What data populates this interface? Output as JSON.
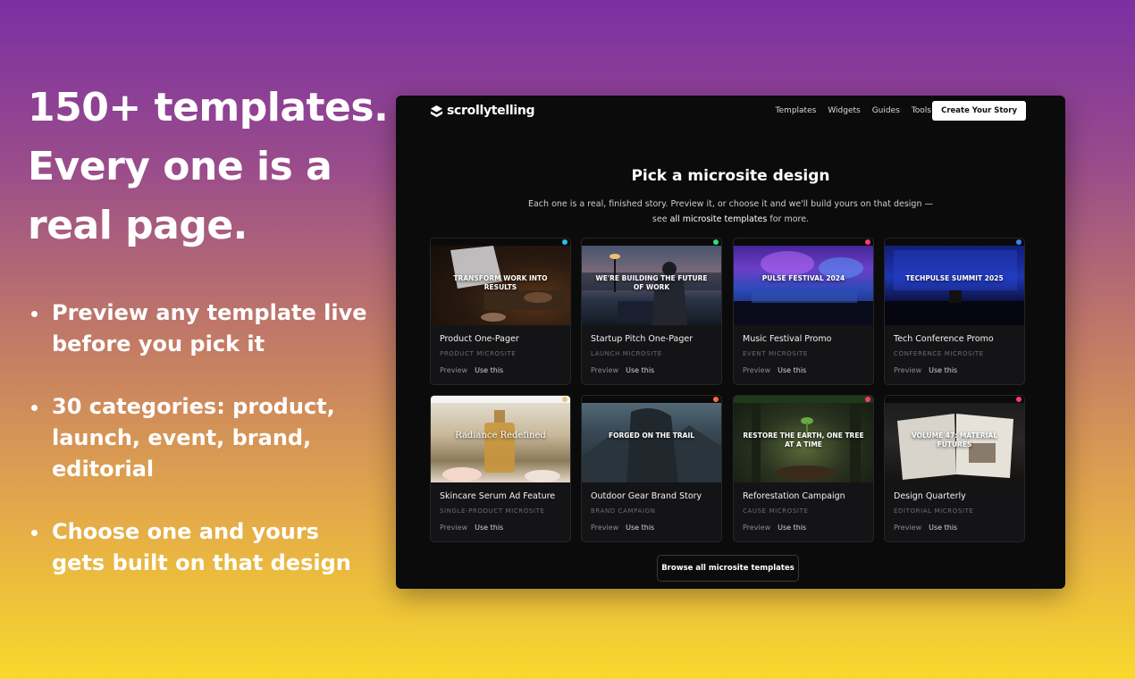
{
  "hero": {
    "line1": "150+ templates.",
    "line2": "Every one is a",
    "line3": "real page."
  },
  "bullets": [
    "Preview any template live before you pick it",
    "30 categories: product, launch, event, brand, editorial",
    "Choose one and yours gets built on that design"
  ],
  "site": {
    "brand": "scrollytelling",
    "nav": [
      "Templates",
      "Widgets",
      "Guides",
      "Tools"
    ],
    "cta": "Create Your Story",
    "heading": "Pick a microsite design",
    "sub_text": "Each one is a real, finished story. Preview it, or choose it and we'll build yours on that design — see",
    "sub_link": "all microsite templates",
    "sub_end": "for more.",
    "preview_label": "Preview",
    "use_label": "Use this",
    "browse_label": "Browse all microsite templates",
    "templates": [
      {
        "thumb_title": "Transform work into results",
        "title": "Product One-Pager",
        "category": "PRODUCT MICROSITE",
        "dot_color": "#22c3e6",
        "icon": "laptop-scene"
      },
      {
        "thumb_title": "We're building the future of work",
        "title": "Startup Pitch One-Pager",
        "category": "LAUNCH MICROSITE",
        "dot_color": "#2ee07a",
        "icon": "office-scene"
      },
      {
        "thumb_title": "Pulse Festival 2024",
        "title": "Music Festival Promo",
        "category": "EVENT MICROSITE",
        "dot_color": "#ff3b6b",
        "icon": "concert-scene"
      },
      {
        "thumb_title": "TechPulse Summit 2025",
        "title": "Tech Conference Promo",
        "category": "CONFERENCE MICROSITE",
        "dot_color": "#3b82f6",
        "icon": "stage-scene"
      },
      {
        "thumb_title": "Radiance Redefined",
        "title": "Skincare Serum Ad Feature",
        "category": "SINGLE-PRODUCT MICROSITE",
        "dot_color": "#e8c77a",
        "icon": "serum-bottle"
      },
      {
        "thumb_title": "Forged on the trail",
        "title": "Outdoor Gear Brand Story",
        "category": "BRAND CAMPAIGN",
        "dot_color": "#ff6a3d",
        "icon": "hiker-scene"
      },
      {
        "thumb_title": "Restore the earth, one tree at a time",
        "title": "Reforestation Campaign",
        "category": "CAUSE MICROSITE",
        "dot_color": "#ff3b6b",
        "icon": "forest-sprout"
      },
      {
        "thumb_title": "Volume 47: Material Futures",
        "title": "Design Quarterly",
        "category": "EDITORIAL MICROSITE",
        "dot_color": "#ff3b6b",
        "icon": "open-book"
      }
    ]
  },
  "colors": {
    "bg_top": "#7b2fa3",
    "bg_bottom": "#f8d92c",
    "frame_bg": "#0b0b0c",
    "card_bg": "#141416"
  }
}
